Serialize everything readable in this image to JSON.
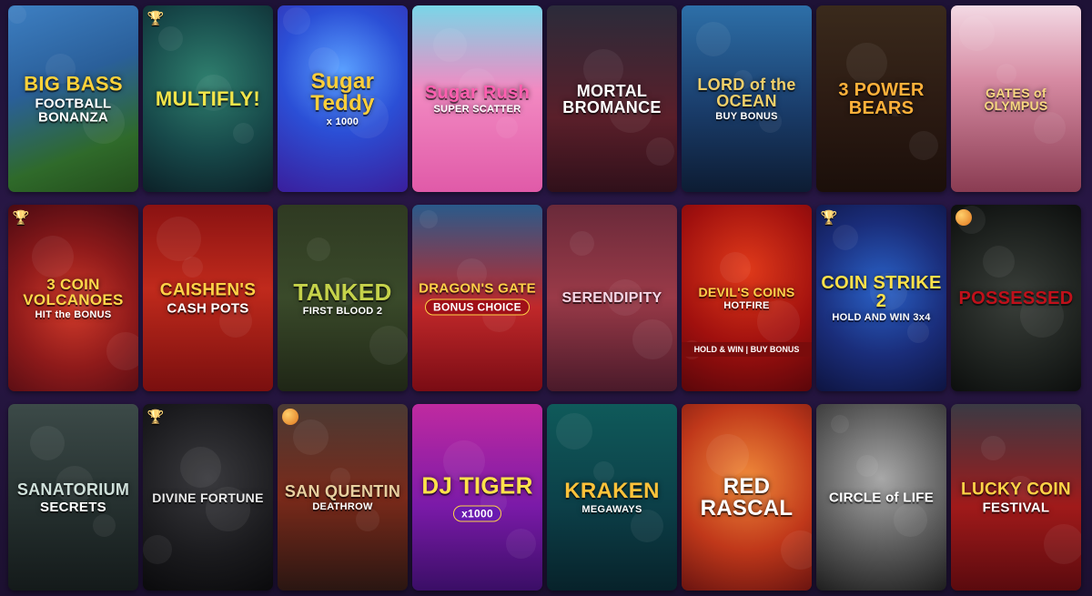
{
  "tiles": [
    {
      "id": "big-bass-football",
      "title": "BIG BASS",
      "sub": "FOOTBALL BONANZA",
      "badge": "",
      "bg": "linear-gradient(160deg,#3d7fc2 0%,#2a5f9a 40%,#2f6a2a 75%,#234d1c 100%)",
      "color": "#ffd23a",
      "size": 22
    },
    {
      "id": "multifly",
      "title": "MULTIFLY!",
      "sub": "",
      "badge": "trophy",
      "bg": "radial-gradient(circle at 50% 40%,#2f7f6e 0%,#17494a 55%,#0c2027 100%)",
      "color": "#f3e54a",
      "size": 22
    },
    {
      "id": "sugar-teddy",
      "title": "Sugar Teddy",
      "sub": "x 1000",
      "badge": "",
      "bg": "radial-gradient(circle at 50% 35%,#5aa0ff 0%,#2b4fd6 45%,#3a1e9c 100%)",
      "color": "#ffcf3a",
      "size": 24
    },
    {
      "id": "sugar-rush",
      "title": "Sugar Rush",
      "sub": "SUPER SCATTER",
      "badge": "",
      "bg": "linear-gradient(180deg,#79d6e8 0%,#f28ac2 45%,#e05aa8 100%)",
      "color": "#ff5fb0",
      "size": 20
    },
    {
      "id": "mortal-bromance",
      "title": "MORTAL BROMANCE",
      "sub": "",
      "badge": "",
      "bg": "linear-gradient(180deg,#2b2b3a 0%,#5a1f2a 60%,#30101a 100%)",
      "color": "#ffffff",
      "size": 18
    },
    {
      "id": "lord-of-the-ocean",
      "title": "LORD of the OCEAN",
      "sub": "BUY BONUS",
      "badge": "",
      "bg": "linear-gradient(180deg,#2d6fa8 0%,#1a3d6b 55%,#0d1c33 100%)",
      "color": "#f0cf6a",
      "size": 18
    },
    {
      "id": "3-power-bears",
      "title": "3 POWER BEARS",
      "sub": "",
      "badge": "",
      "bg": "linear-gradient(180deg,#3a2a1c 0%,#2b1a12 55%,#1b0f0a 100%)",
      "color": "#ffb13a",
      "size": 20
    },
    {
      "id": "gates-of-olympus",
      "title": "GATES of OLYMPUS",
      "sub": "",
      "badge": "",
      "bg": "linear-gradient(180deg,#f3d9e4 0%,#d68aa2 40%,#8a3c52 100%)",
      "color": "#f7d780",
      "size": 14
    },
    {
      "id": "3-coin-volcanoes",
      "title": "3 COIN VOLCANOES",
      "sub": "HIT the BONUS",
      "badge": "trophy",
      "bg": "radial-gradient(circle at 50% 55%,#d13a2a 0%,#8e1a1a 50%,#4a0a12 100%)",
      "color": "#ffd84a",
      "size": 17
    },
    {
      "id": "caishens-cash-pots",
      "title": "CAISHEN'S",
      "sub": "CASH POTS",
      "badge": "",
      "bg": "linear-gradient(180deg,#8a1212 0%,#c02a1c 45%,#7a0f0f 100%)",
      "color": "#ffd347",
      "size": 19
    },
    {
      "id": "tanked",
      "title": "TANKED",
      "sub": "FIRST BLOOD 2",
      "badge": "",
      "bg": "linear-gradient(180deg,#2f3a22 0%,#3a4a2a 50%,#1f2616 100%)",
      "color": "#c5d24a",
      "size": 26
    },
    {
      "id": "dragons-gate",
      "title": "DRAGON'S GATE",
      "sub": "BONUS CHOICE",
      "badge": "",
      "bg": "linear-gradient(180deg,#2a5a8a 0%,#c0282a 55%,#7a0c14 100%)",
      "color": "#ffd047",
      "size": 15
    },
    {
      "id": "serendipity",
      "title": "SERENDIPITY",
      "sub": "",
      "badge": "",
      "bg": "linear-gradient(180deg,#6a2a3a 0%,#9a3a48 50%,#4a1a2a 100%)",
      "color": "#f5d7e6",
      "size": 16
    },
    {
      "id": "devils-coins",
      "title": "DEVIL'S COINS",
      "sub": "HOTFIRE",
      "badge": "",
      "bg": "radial-gradient(circle at 50% 35%,#e03a1a 0%,#a0100e 55%,#5a060a 100%)",
      "color": "#ffd24a",
      "size": 14,
      "strip": "HOLD & WIN | BUY BONUS"
    },
    {
      "id": "coin-strike-2",
      "title": "COIN STRIKE 2",
      "sub": "HOLD AND WIN 3x4",
      "badge": "trophy",
      "bg": "radial-gradient(circle at 50% 45%,#2a62c8 0%,#1a2d7a 55%,#0e1440 100%)",
      "color": "#ffe24a",
      "size": 20
    },
    {
      "id": "possessed",
      "title": "POSSESSED",
      "sub": "",
      "badge": "dot",
      "bg": "radial-gradient(circle at 50% 50%,#3a3f3a 0%,#1e221f 60%,#0c0e0d 100%)",
      "color": "#c0101a",
      "size": 20
    },
    {
      "id": "sanatorium-secrets",
      "title": "SANATORIUM",
      "sub": "SECRETS",
      "badge": "",
      "bg": "linear-gradient(180deg,#3c4a48 0%,#25302f 55%,#141a1a 100%)",
      "color": "#cfe0da",
      "size": 18
    },
    {
      "id": "divine-fortune",
      "title": "DIVINE FORTUNE",
      "sub": "",
      "badge": "trophy",
      "bg": "radial-gradient(circle at 50% 40%,#3a3a3e 0%,#1a1a1d 60%,#0a0a0c 100%)",
      "color": "#e8e8e8",
      "size": 14
    },
    {
      "id": "san-quentin",
      "title": "SAN QUENTIN",
      "sub": "DEATHROW",
      "badge": "dot",
      "bg": "linear-gradient(180deg,#4a3a34 0%,#7a2a1a 50%,#2a1612 100%)",
      "color": "#e8d0a0",
      "size": 18
    },
    {
      "id": "dj-tiger",
      "title": "DJ TIGER",
      "sub": "x1000",
      "badge": "",
      "bg": "linear-gradient(180deg,#c02aa0 0%,#7a1aa8 55%,#3a0e66 100%)",
      "color": "#ffe24a",
      "size": 26
    },
    {
      "id": "release-the-kraken",
      "title": "KRAKEN",
      "sub": "MEGAWAYS",
      "badge": "",
      "bg": "linear-gradient(180deg,#0f5a5a 0%,#0c3f48 55%,#07222a 100%)",
      "color": "#ffc23a",
      "size": 24
    },
    {
      "id": "red-rascal",
      "title": "RED RASCAL",
      "sub": "",
      "badge": "",
      "bg": "radial-gradient(circle at 50% 40%,#f08a3a 0%,#c0381a 55%,#6a1410 100%)",
      "color": "#ffffff",
      "size": 24
    },
    {
      "id": "circle-of-life",
      "title": "CIRCLE of LIFE",
      "sub": "",
      "badge": "",
      "bg": "radial-gradient(circle at 50% 40%,#a8a8a8 0%,#5a5a5a 55%,#1e1e1e 100%)",
      "color": "#ffffff",
      "size": 15
    },
    {
      "id": "lucky-coin-festival",
      "title": "LUCKY COIN",
      "sub": "FESTIVAL",
      "badge": "",
      "bg": "linear-gradient(180deg,#3a3a44 0%,#a01a1a 55%,#5a0a0e 100%)",
      "color": "#ffd347",
      "size": 19
    }
  ]
}
